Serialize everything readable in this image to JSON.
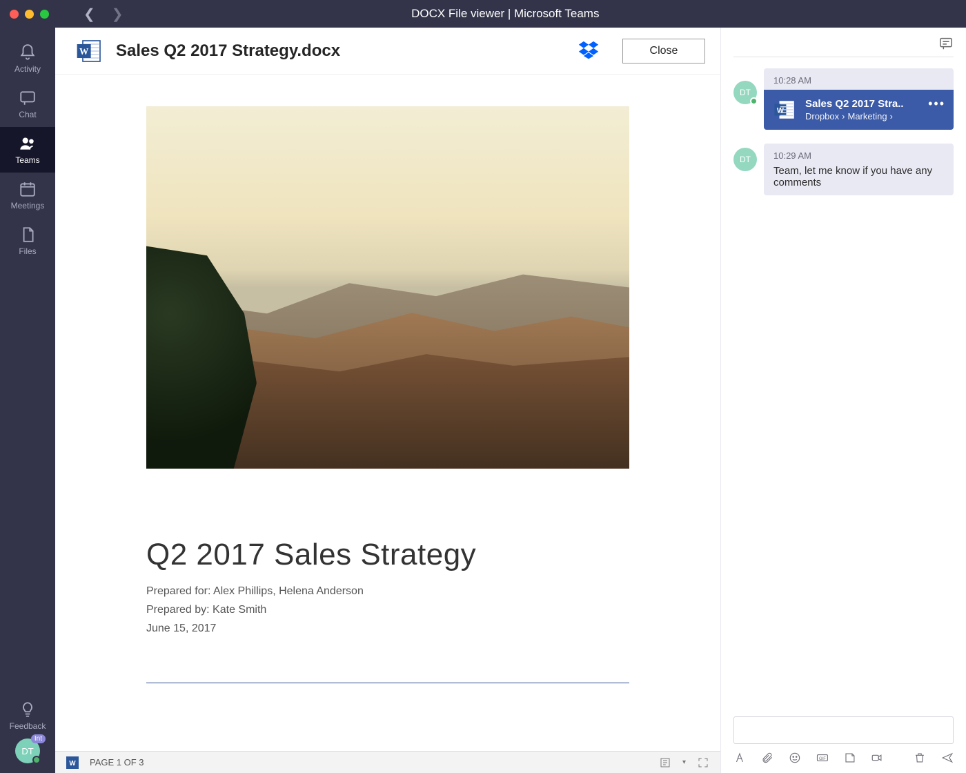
{
  "titlebar": {
    "title": "DOCX File viewer | Microsoft Teams"
  },
  "rail": {
    "items": [
      {
        "id": "activity",
        "label": "Activity"
      },
      {
        "id": "chat",
        "label": "Chat"
      },
      {
        "id": "teams",
        "label": "Teams"
      },
      {
        "id": "meetings",
        "label": "Meetings"
      },
      {
        "id": "files",
        "label": "Files"
      }
    ],
    "feedback_label": "Feedback",
    "avatar_initials": "DT",
    "avatar_badge": "Int"
  },
  "doc": {
    "filename": "Sales Q2 2017 Strategy.docx",
    "close_label": "Close",
    "heading": "Q2 2017 Sales Strategy",
    "prepared_for": "Prepared for: Alex Phillips, Helena Anderson",
    "prepared_by": "Prepared by: Kate Smith",
    "date": "June 15, 2017",
    "page_status": "PAGE 1 OF 3"
  },
  "chat": {
    "avatar_initials": "DT",
    "msg1_time": "10:28 AM",
    "file_title": "Sales Q2 2017 Stra..",
    "file_path_1": "Dropbox",
    "file_path_2": "Marketing",
    "msg2_time": "10:29 AM",
    "msg2_text": "Team, let me know if you have any comments"
  }
}
